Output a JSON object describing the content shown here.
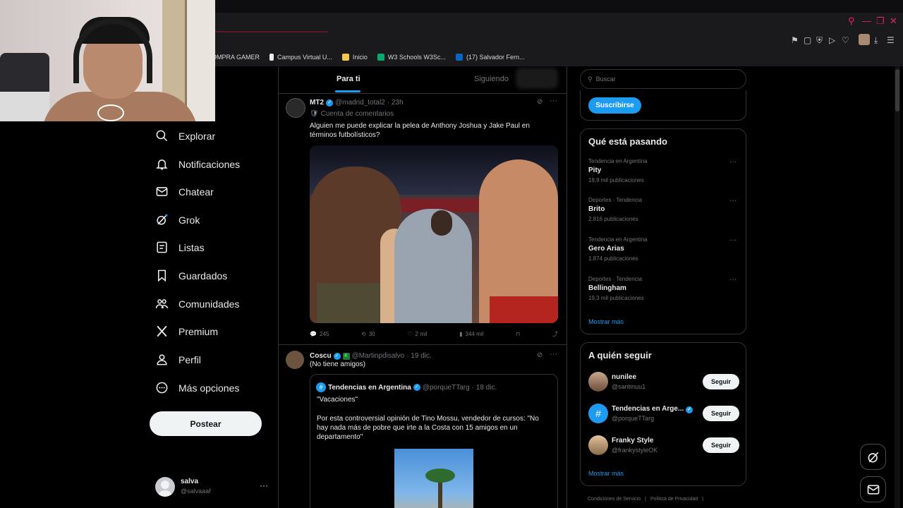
{
  "browser": {
    "bookmarks": [
      {
        "label": "OMPRA GAMER",
        "color": "#2b2b2b"
      },
      {
        "label": "Campus Virtual U...",
        "color": "#eeeeee"
      },
      {
        "label": "Inicio",
        "color": "#f2c94c"
      },
      {
        "label": "W3 Schools W3Sc...",
        "color": "#04aa6d"
      },
      {
        "label": "(17) Salvador Fern...",
        "color": "#0a66c2"
      }
    ],
    "accent": "#e0245e"
  },
  "nav": {
    "items": [
      {
        "label": "Explorar",
        "icon": "search-icon"
      },
      {
        "label": "Notificaciones",
        "icon": "bell-icon"
      },
      {
        "label": "Chatear",
        "icon": "mail-icon"
      },
      {
        "label": "Grok",
        "icon": "grok-icon"
      },
      {
        "label": "Listas",
        "icon": "list-icon"
      },
      {
        "label": "Guardados",
        "icon": "bookmark-icon"
      },
      {
        "label": "Comunidades",
        "icon": "people-icon"
      },
      {
        "label": "Premium",
        "icon": "x-logo-icon"
      },
      {
        "label": "Perfil",
        "icon": "person-icon"
      },
      {
        "label": "Más opciones",
        "icon": "more-circle-icon"
      }
    ],
    "post_label": "Postear",
    "account": {
      "name": "salva",
      "handle": "@salvaaaf",
      "more": "···"
    }
  },
  "feed": {
    "tabs": {
      "for_you": "Para ti",
      "following": "Siguiendo"
    },
    "tweets": [
      {
        "name": "MT2",
        "handle": "@madrid_total2",
        "time": "· 23h",
        "context": "Cuenta de comentarios",
        "text": "Alguien me puede explicar la pelea de Anthony Joshua y Jake Paul en términos futbolísticos?",
        "stats": {
          "replies": "245",
          "reposts": "30",
          "likes": "2 mil",
          "views": "344 mil"
        }
      },
      {
        "name": "Coscu",
        "handle": "@Martinpdisalvo",
        "time": "· 19 dic.",
        "text": "(No tiene amigos)",
        "quote": {
          "name": "Tendencias en Argentina",
          "handle": "@porqueTTarg",
          "time": "· 18 dic.",
          "line1": "\"Vacaciones\"",
          "line2": "Por esta controversial opinión de Tino Mossu, vendedor de cursos: \"No hay nada más de pobre que irte a la Costa con 15 amigos en un departamento\""
        }
      }
    ]
  },
  "right": {
    "search_placeholder": "Buscar",
    "subscribe_label": "Suscribirse",
    "trending_title": "Qué está pasando",
    "trends": [
      {
        "meta": "Tendencia en Argentina",
        "name": "Pity",
        "count": "18,9 mil publicaciones"
      },
      {
        "meta": "Deportes · Tendencia",
        "name": "Brito",
        "count": "2.816 publicaciones"
      },
      {
        "meta": "Tendencia en Argentina",
        "name": "Gero Arias",
        "count": "1.874 publicaciones"
      },
      {
        "meta": "Deportes · Tendencia",
        "name": "Bellingham",
        "count": "19,3 mil publicaciones"
      }
    ],
    "show_more": "Mostrar más",
    "who_to_follow_title": "A quién seguir",
    "follow": [
      {
        "name": "nunilee",
        "handle": "@santinuu1",
        "button": "Seguir",
        "color": "#8a6a5a"
      },
      {
        "name": "Tendencias en Arge...",
        "handle": "@porqueTTarg",
        "button": "Seguir",
        "color": "#1d9bf0"
      },
      {
        "name": "Franky Style",
        "handle": "@frankystyleOK",
        "button": "Seguir",
        "color": "#c9a07a"
      }
    ],
    "show_more_follow": "Mostrar más",
    "footer": [
      "Condiciones de Servicio",
      "Política de Privacidad"
    ]
  }
}
